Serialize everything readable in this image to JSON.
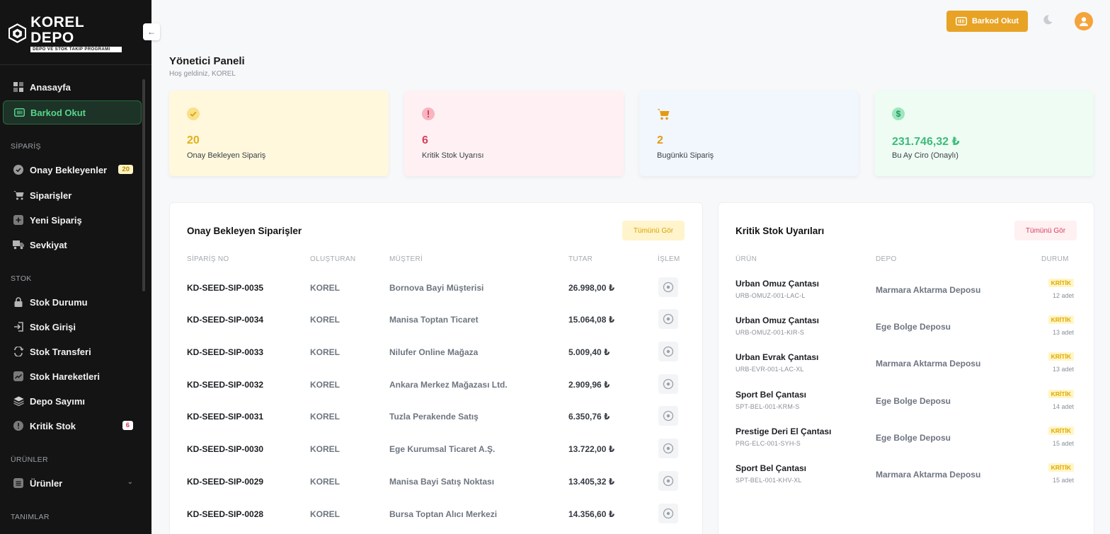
{
  "brand": {
    "name": "KOREL DEPO",
    "tagline": "DEPO VE STOK TAKİP PROGRAMI"
  },
  "sidebar": {
    "items": [
      {
        "label": "Anasayfa",
        "icon": "dashboard-icon"
      },
      {
        "label": "Barkod Okut",
        "icon": "barcode-icon",
        "active": true
      }
    ],
    "sections": [
      {
        "title": "SİPARİŞ",
        "items": [
          {
            "label": "Onay Bekleyenler",
            "icon": "check-circle-icon",
            "badge": "20"
          },
          {
            "label": "Siparişler",
            "icon": "cart-icon"
          },
          {
            "label": "Yeni Sipariş",
            "icon": "plus-icon"
          },
          {
            "label": "Sevkiyat",
            "icon": "truck-icon"
          }
        ]
      },
      {
        "title": "STOK",
        "items": [
          {
            "label": "Stok Durumu",
            "icon": "lock-icon"
          },
          {
            "label": "Stok Girişi",
            "icon": "login-icon"
          },
          {
            "label": "Stok Transferi",
            "icon": "transfer-icon"
          },
          {
            "label": "Stok Hareketleri",
            "icon": "trend-icon"
          },
          {
            "label": "Depo Sayımı",
            "icon": "layers-icon"
          },
          {
            "label": "Kritik Stok",
            "icon": "alert-icon",
            "badge": "6"
          }
        ]
      },
      {
        "title": "ÜRÜNLER",
        "items": [
          {
            "label": "Ürünler",
            "icon": "list-icon"
          }
        ]
      },
      {
        "title": "TANIMLAR",
        "items": []
      }
    ]
  },
  "topbar": {
    "barkod_label": "Barkod Okut"
  },
  "page": {
    "title": "Yönetici Paneli",
    "subtitle": "Hoş geldiniz, KOREL"
  },
  "stats": [
    {
      "value": "20",
      "label": "Onay Bekleyen Sipariş",
      "color": "#e2b11a",
      "bg": "#fff8dc"
    },
    {
      "value": "6",
      "label": "Kritik Stok Uyarısı",
      "color": "#d6415c",
      "bg": "#fff1f3"
    },
    {
      "value": "2",
      "label": "Bugünkü Sipariş",
      "color": "#e49a17",
      "bg": "#f1f7fc"
    },
    {
      "value": "231.746,32 ₺",
      "label": "Bu Ay Ciro (Onaylı)",
      "color": "#3dbb7a",
      "bg": "#eefcf4"
    }
  ],
  "orders": {
    "title": "Onay Bekleyen Siparişler",
    "view_all": "Tümünü Gör",
    "columns": [
      "SİPARİŞ NO",
      "OLUŞTURAN",
      "MÜŞTERİ",
      "TUTAR",
      "İŞLEM"
    ],
    "rows": [
      {
        "no": "KD-SEED-SIP-0035",
        "creator": "KOREL",
        "customer": "Bornova Bayi Müşterisi",
        "amount": "26.998,00 ₺"
      },
      {
        "no": "KD-SEED-SIP-0034",
        "creator": "KOREL",
        "customer": "Manisa Toptan Ticaret",
        "amount": "15.064,08 ₺"
      },
      {
        "no": "KD-SEED-SIP-0033",
        "creator": "KOREL",
        "customer": "Nilufer Online Mağaza",
        "amount": "5.009,40 ₺"
      },
      {
        "no": "KD-SEED-SIP-0032",
        "creator": "KOREL",
        "customer": "Ankara Merkez Mağazası Ltd.",
        "amount": "2.909,96 ₺"
      },
      {
        "no": "KD-SEED-SIP-0031",
        "creator": "KOREL",
        "customer": "Tuzla Perakende Satış",
        "amount": "6.350,76 ₺"
      },
      {
        "no": "KD-SEED-SIP-0030",
        "creator": "KOREL",
        "customer": "Ege Kurumsal Ticaret A.Ş.",
        "amount": "13.722,00 ₺"
      },
      {
        "no": "KD-SEED-SIP-0029",
        "creator": "KOREL",
        "customer": "Manisa Bayi Satış Noktası",
        "amount": "13.405,32 ₺"
      },
      {
        "no": "KD-SEED-SIP-0028",
        "creator": "KOREL",
        "customer": "Bursa Toptan Alıcı Merkezi",
        "amount": "14.356,60 ₺"
      }
    ]
  },
  "stock": {
    "title": "Kritik Stok Uyarıları",
    "view_all": "Tümünü Gör",
    "columns": [
      "ÜRÜN",
      "DEPO",
      "DURUM"
    ],
    "rows": [
      {
        "name": "Urban Omuz Çantası",
        "code": "URB-OMUZ-001-LAC-L",
        "depot": "Marmara Aktarma Deposu",
        "status": "KRİTİK",
        "qty": "12 adet"
      },
      {
        "name": "Urban Omuz Çantası",
        "code": "URB-OMUZ-001-KIR-S",
        "depot": "Ege Bolge Deposu",
        "status": "KRİTİK",
        "qty": "13 adet"
      },
      {
        "name": "Urban Evrak Çantası",
        "code": "URB-EVR-001-LAC-XL",
        "depot": "Marmara Aktarma Deposu",
        "status": "KRİTİK",
        "qty": "13 adet"
      },
      {
        "name": "Sport Bel Çantası",
        "code": "SPT-BEL-001-KRM-S",
        "depot": "Ege Bolge Deposu",
        "status": "KRİTİK",
        "qty": "14 adet"
      },
      {
        "name": "Prestige Deri El Çantası",
        "code": "PRG-ELC-001-SYH-S",
        "depot": "Ege Bolge Deposu",
        "status": "KRİTİK",
        "qty": "15 adet"
      },
      {
        "name": "Sport Bel Çantası",
        "code": "SPT-BEL-001-KHV-XL",
        "depot": "Marmara Aktarma Deposu",
        "status": "KRİTİK",
        "qty": "15 adet"
      }
    ]
  }
}
